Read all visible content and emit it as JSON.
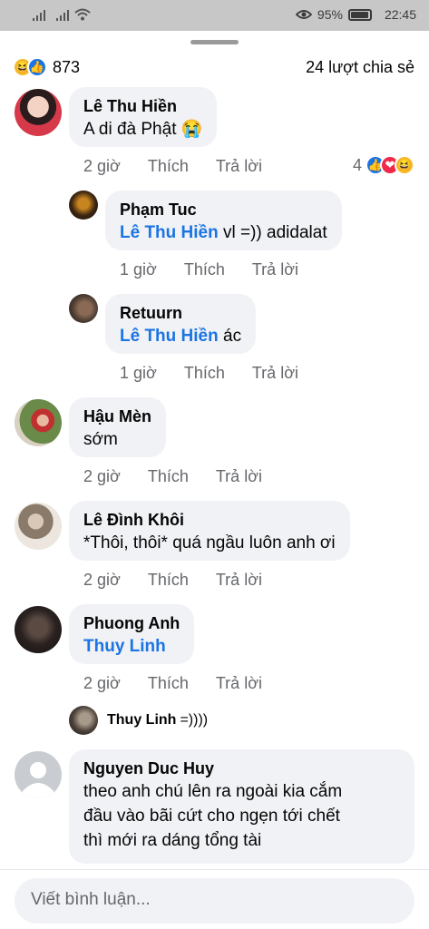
{
  "status_bar": {
    "battery_percent": "95%",
    "time": "22:45"
  },
  "summary": {
    "reaction_count": "873",
    "shares": "24 lượt chia sẻ"
  },
  "comments": [
    {
      "name": "Lê Thu Hiền",
      "text": "A di đà Phật 😭",
      "time": "2 giờ",
      "like": "Thích",
      "reply": "Trả lời",
      "react_count": "4"
    },
    {
      "name": "Phạm Tuc",
      "tag": "Lê Thu Hiền",
      "text": " vl =)) adidalat",
      "time": "1 giờ",
      "like": "Thích",
      "reply": "Trả lời"
    },
    {
      "name": "Retuurn",
      "tag": "Lê Thu Hiền",
      "text": " ác",
      "time": "1 giờ",
      "like": "Thích",
      "reply": "Trả lời"
    },
    {
      "name": "Hậu Mèn",
      "text": "sớm",
      "time": "2 giờ",
      "like": "Thích",
      "reply": "Trả lời"
    },
    {
      "name": "Lê Đình Khôi",
      "text": "*Thôi, thôi* quá ngầu luôn anh ơi",
      "time": "2 giờ",
      "like": "Thích",
      "reply": "Trả lời"
    },
    {
      "name": "Phuong Anh",
      "tag": "Thuy Linh",
      "time": "2 giờ",
      "like": "Thích",
      "reply": "Trả lời"
    },
    {
      "name": "Nguyen Duc Huy",
      "text_lines": [
        "theo anh chú lên ra ngoài kia cắm",
        "đầu vào bãi cứt cho ngẹn tới chết",
        "thì mới ra dáng tổng tài"
      ]
    }
  ],
  "mini_reply": {
    "name": "Thuy Linh",
    "text": "=))))"
  },
  "composer": {
    "placeholder": "Viết bình luận..."
  },
  "colors": {
    "link_blue": "#1b74e4",
    "bubble_bg": "#f0f2f5",
    "meta_gray": "#65676b"
  }
}
